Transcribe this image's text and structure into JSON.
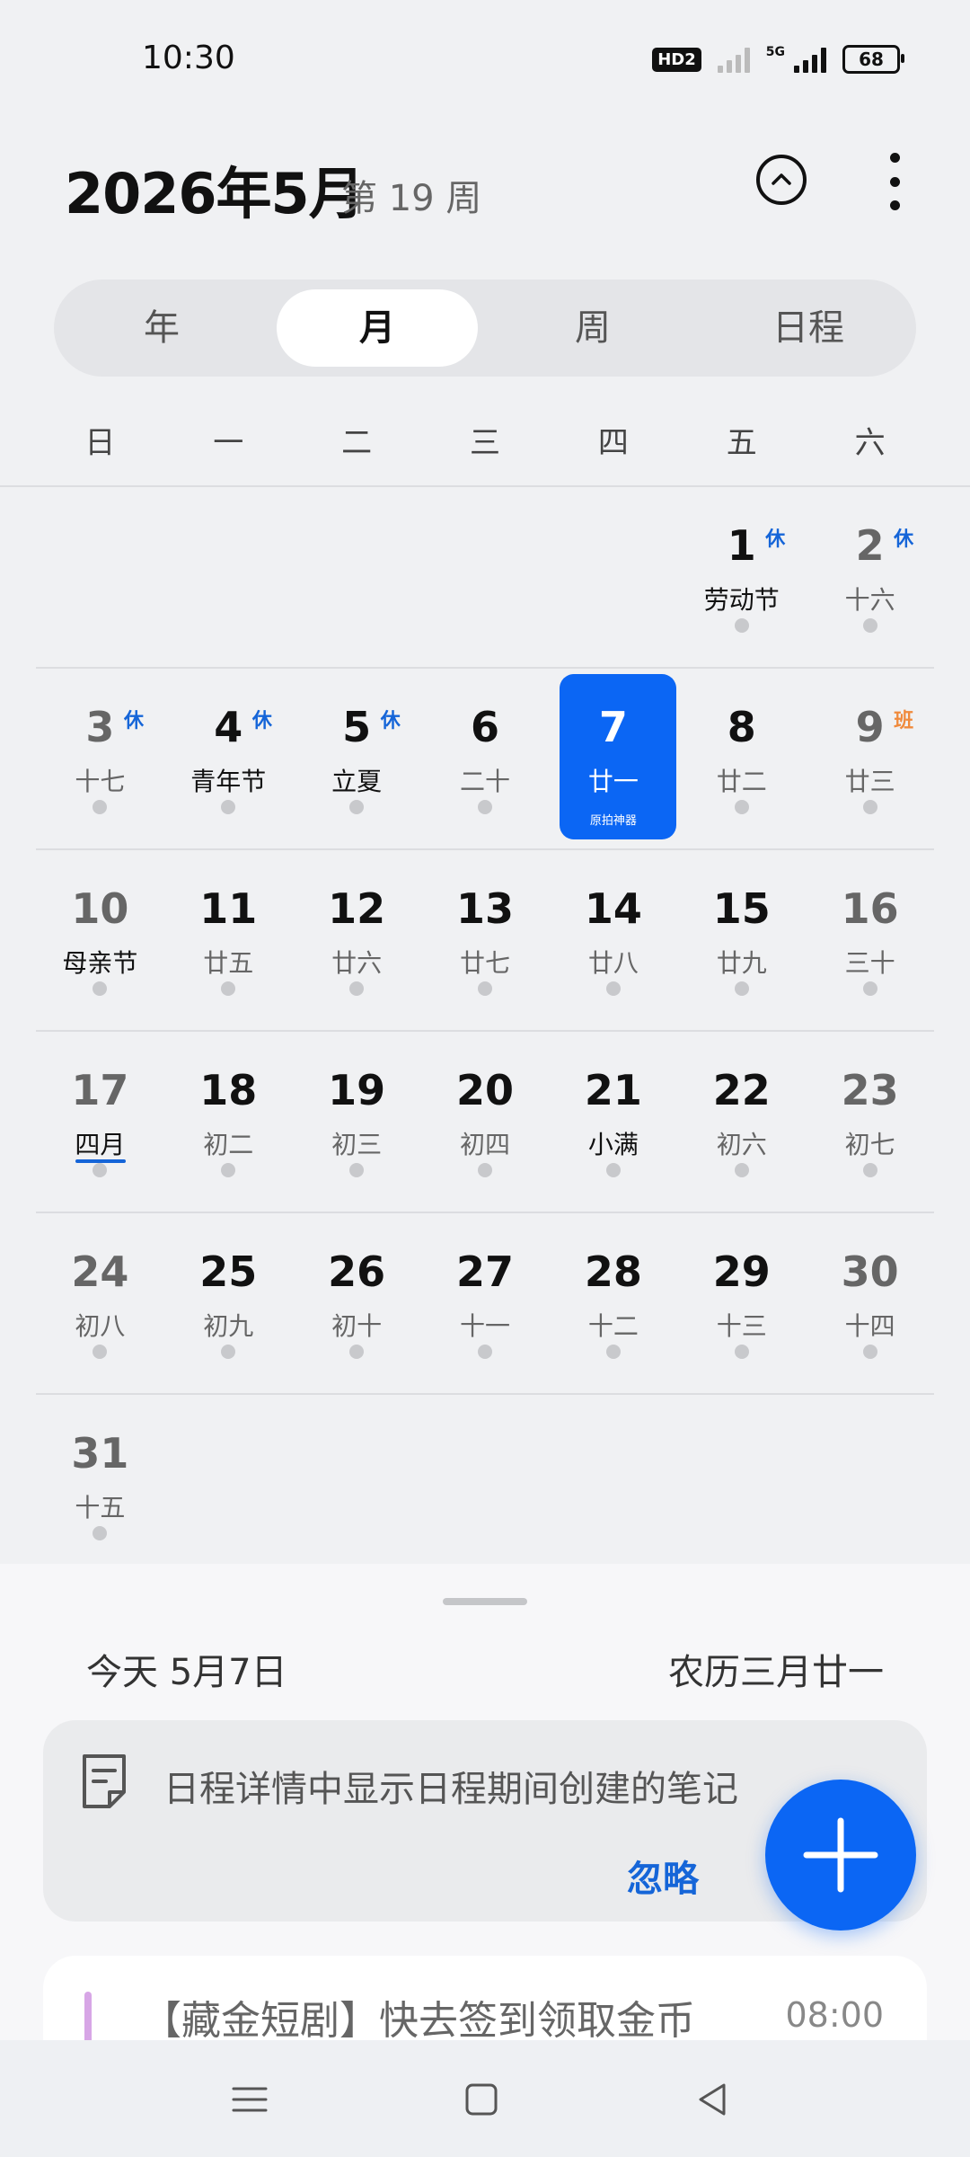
{
  "status": {
    "time": "10:30",
    "hd": "HD2",
    "network": "5G",
    "battery": "68"
  },
  "header": {
    "title": "2026年5月",
    "week": "第 19 周"
  },
  "tabs": [
    {
      "label": "年",
      "active": false
    },
    {
      "label": "月",
      "active": true
    },
    {
      "label": "周",
      "active": false
    },
    {
      "label": "日程",
      "active": false
    }
  ],
  "weekdays": [
    "日",
    "一",
    "二",
    "三",
    "四",
    "五",
    "六"
  ],
  "calendar": {
    "rows": [
      [
        null,
        null,
        null,
        null,
        null,
        {
          "day": "1",
          "lunar": "劳动节",
          "tag": "休"
        },
        {
          "day": "2",
          "lunar": "十六",
          "tag": "休"
        }
      ],
      [
        {
          "day": "3",
          "lunar": "十七",
          "tag": "休"
        },
        {
          "day": "4",
          "lunar": "青年节",
          "tag": "休"
        },
        {
          "day": "5",
          "lunar": "立夏",
          "tag": "休"
        },
        {
          "day": "6",
          "lunar": "二十"
        },
        {
          "day": "7",
          "lunar": "廿一",
          "mini": "原拍神器"
        },
        {
          "day": "8",
          "lunar": "廿二"
        },
        {
          "day": "9",
          "lunar": "廿三",
          "tag": "班"
        }
      ],
      [
        {
          "day": "10",
          "lunar": "母亲节"
        },
        {
          "day": "11",
          "lunar": "廿五"
        },
        {
          "day": "12",
          "lunar": "廿六"
        },
        {
          "day": "13",
          "lunar": "廿七"
        },
        {
          "day": "14",
          "lunar": "廿八"
        },
        {
          "day": "15",
          "lunar": "廿九"
        },
        {
          "day": "16",
          "lunar": "三十"
        }
      ],
      [
        {
          "day": "17",
          "lunar": "四月"
        },
        {
          "day": "18",
          "lunar": "初二"
        },
        {
          "day": "19",
          "lunar": "初三"
        },
        {
          "day": "20",
          "lunar": "初四"
        },
        {
          "day": "21",
          "lunar": "小满"
        },
        {
          "day": "22",
          "lunar": "初六"
        },
        {
          "day": "23",
          "lunar": "初七"
        }
      ],
      [
        {
          "day": "24",
          "lunar": "初八"
        },
        {
          "day": "25",
          "lunar": "初九"
        },
        {
          "day": "26",
          "lunar": "初十"
        },
        {
          "day": "27",
          "lunar": "十一"
        },
        {
          "day": "28",
          "lunar": "十二"
        },
        {
          "day": "29",
          "lunar": "十三"
        },
        {
          "day": "30",
          "lunar": "十四"
        }
      ],
      [
        {
          "day": "31",
          "lunar": "十五"
        },
        null,
        null,
        null,
        null,
        null,
        null
      ]
    ]
  },
  "sheet": {
    "today": "今天  5月7日",
    "lunar_date": "农历三月廿一",
    "tip": {
      "text": "日程详情中显示日程期间创建的笔记",
      "ignore": "忽略"
    },
    "event": {
      "title": "【藏金短剧】快去签到领取金币",
      "time": "08:00",
      "color": "#d7a6e6"
    }
  },
  "colors": {
    "accent": "#0b66f4",
    "holiday_tag": "#1565d8",
    "work_tag": "#f08a3c"
  },
  "icons": {
    "collapse": "chevron-up-circle-icon",
    "more": "more-vertical-icon",
    "note": "note-icon",
    "add": "plus-icon"
  }
}
